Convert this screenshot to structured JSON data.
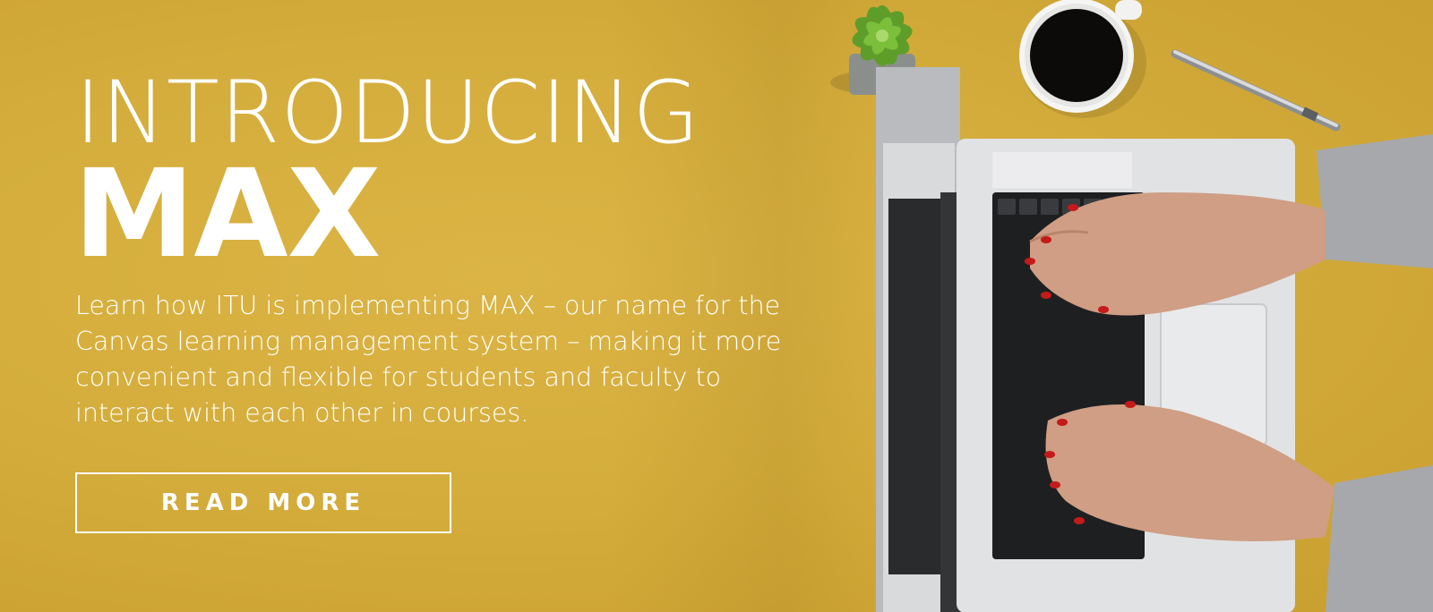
{
  "hero": {
    "intro": "INTRODUCING",
    "headline": "MAX",
    "description": "Learn how ITU is implementing MAX – our name for the Canvas learning management system – making it more convenient and flexible for students and faculty to interact with each other in courses.",
    "cta_label": "READ MORE"
  },
  "photo": {
    "objects": [
      "succulent-plant",
      "coffee-cup",
      "pen",
      "laptop",
      "hands"
    ]
  },
  "colors": {
    "background": "#d4ad3c",
    "text": "#ffffff",
    "laptop": "#d9dadc",
    "keyboard": "#1e1f21",
    "coffee": "#0c0b0a",
    "nail_polish": "#c41a1a",
    "sleeve": "#a6a8ab",
    "plant": "#5f9d2a"
  }
}
